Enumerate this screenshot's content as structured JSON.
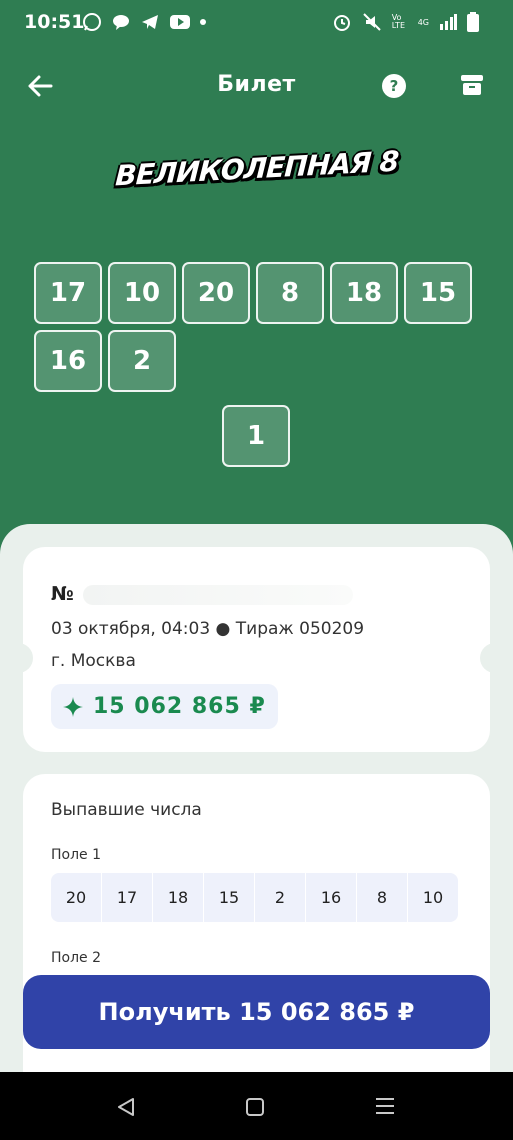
{
  "status_bar": {
    "time": "10:51",
    "network": "Vo LTE",
    "net2": "4G"
  },
  "header": {
    "title": "Билет",
    "help_glyph": "?"
  },
  "logo": {
    "text": "ВЕЛИКОЛЕПНАЯ 8"
  },
  "ticket_numbers": [
    "17",
    "10",
    "20",
    "8",
    "18",
    "15",
    "16",
    "2"
  ],
  "bonus_number": "1",
  "ticket_card": {
    "number_label": "№",
    "date_draw": "03 октября, 04:03 ● Тираж 050209",
    "city": "г. Москва",
    "prize_icon": "sparkle-icon",
    "prize": "15 062 865 ₽"
  },
  "drawn_card": {
    "title": "Выпавшие числа",
    "field1_label": "Поле 1",
    "field1_numbers": [
      "20",
      "17",
      "18",
      "15",
      "2",
      "16",
      "8",
      "10"
    ],
    "field2_label": "Поле 2"
  },
  "cta": {
    "label": "Получить 15 062 865 ₽"
  },
  "colors": {
    "bg_green": "#2f7d52",
    "prize_green": "#1a8a4f",
    "cta_blue": "#3043a8"
  }
}
